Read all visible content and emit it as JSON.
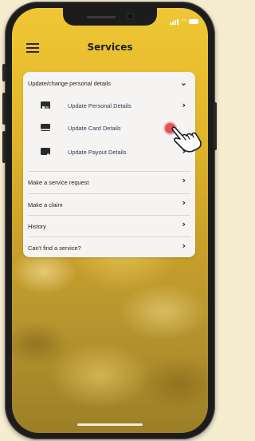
{
  "header": {
    "title": "Services"
  },
  "sections": {
    "update_group": {
      "label": "Update/change personal details",
      "items": [
        {
          "label": "Update Personal Details",
          "icon": "id-card-icon"
        },
        {
          "label": "Update Card Details",
          "icon": "credit-card-icon"
        },
        {
          "label": "Update Payout Details",
          "icon": "wallet-icon"
        }
      ]
    },
    "links": [
      {
        "label": "Make a service request"
      },
      {
        "label": "Make a claim"
      },
      {
        "label": "History"
      },
      {
        "label": "Can't find a service?"
      }
    ]
  },
  "colors": {
    "accent": "#e2b52d",
    "tap_marker": "#e2515a"
  }
}
